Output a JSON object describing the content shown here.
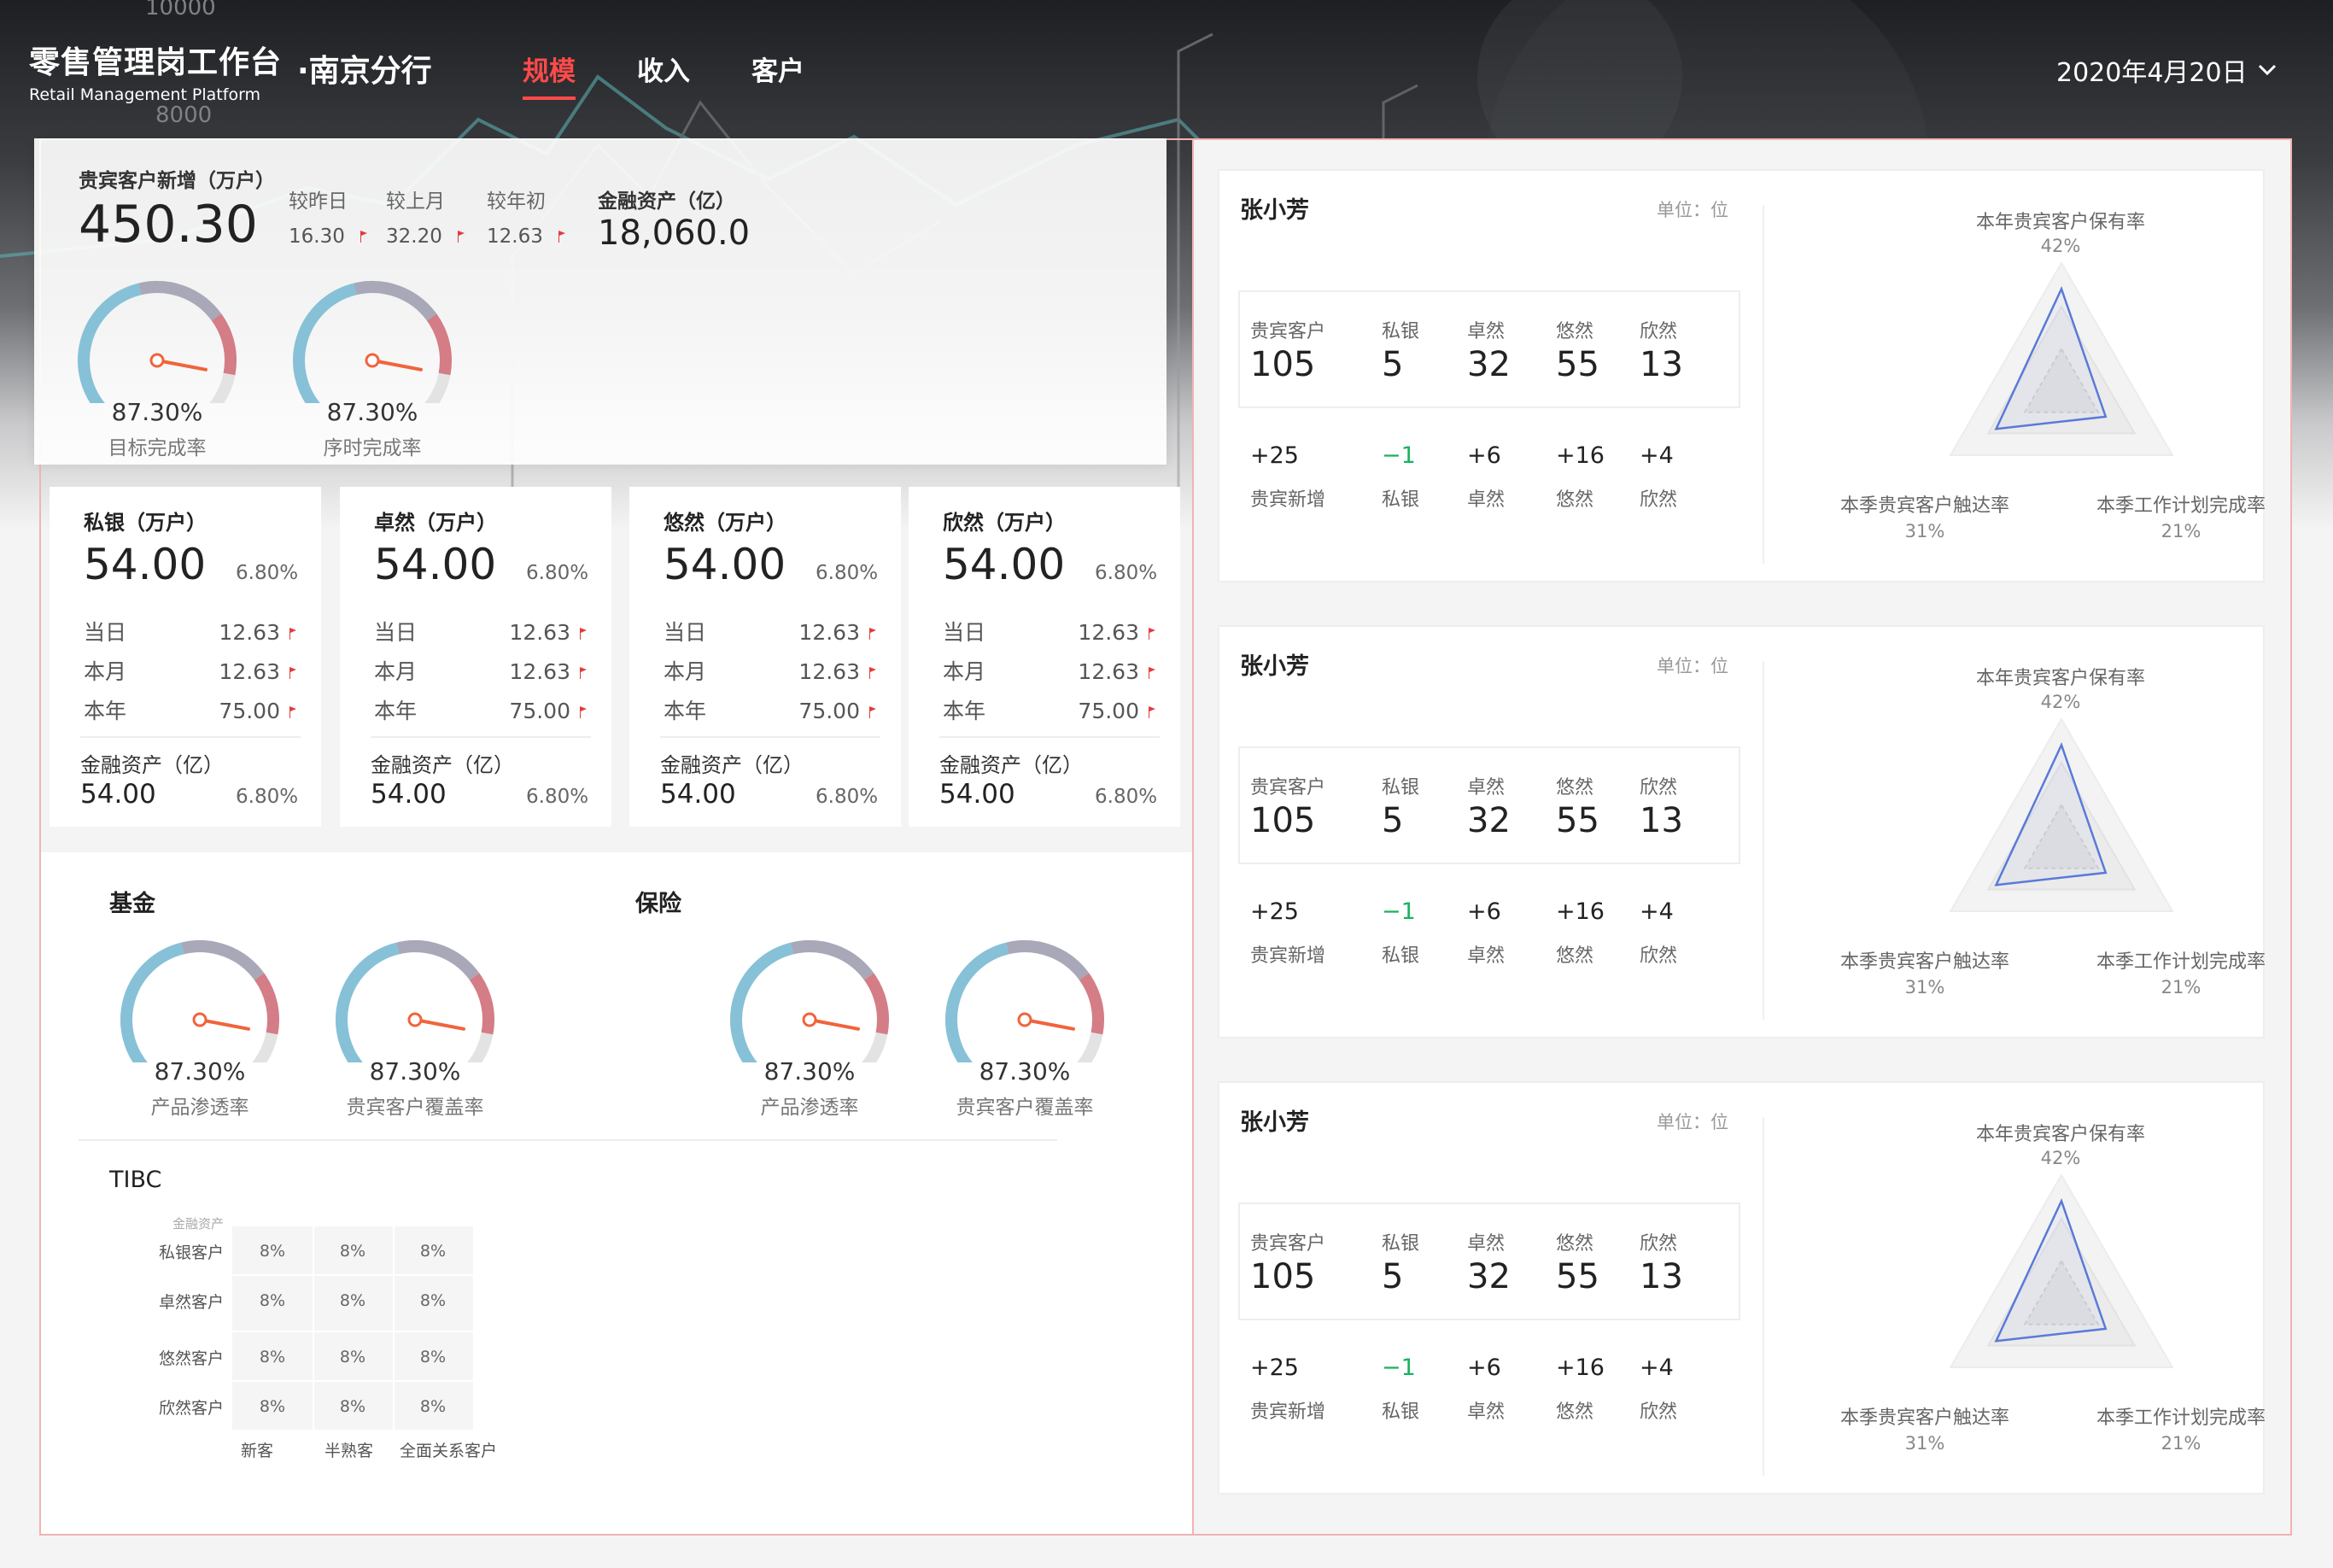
{
  "header": {
    "title_cn": "零售管理岗工作台",
    "title_en": "Retail Management Platform",
    "branch": "·南京分行",
    "tabs": [
      {
        "label": "规模",
        "active": true
      },
      {
        "label": "收入",
        "active": false
      },
      {
        "label": "客户",
        "active": false
      }
    ],
    "date": "2020年4月20日",
    "accent_color": "#ff4a4a",
    "bg_axis_labels": [
      "10000",
      "8000"
    ]
  },
  "summary": {
    "new_vip_label": "贵宾客户新增（万户）",
    "new_vip_value": "450.30",
    "comparisons": [
      {
        "label": "较昨日",
        "value": "16.30"
      },
      {
        "label": "较上月",
        "value": "32.20"
      },
      {
        "label": "较年初",
        "value": "12.63"
      }
    ],
    "assets_label": "金融资产（亿）",
    "assets_value": "18,060.0",
    "gauges": [
      {
        "value": "87.30%",
        "label": "目标完成率",
        "percent": 0.873
      },
      {
        "value": "87.30%",
        "label": "序时完成率",
        "percent": 0.873
      }
    ]
  },
  "segments": [
    {
      "title": "私银（万户）",
      "value": "54.00",
      "pct": "6.80%",
      "rows": [
        {
          "label": "当日",
          "value": "12.63"
        },
        {
          "label": "本月",
          "value": "12.63"
        },
        {
          "label": "本年",
          "value": "75.00"
        }
      ],
      "assets_label": "金融资产（亿）",
      "assets_value": "54.00",
      "assets_pct": "6.80%"
    },
    {
      "title": "卓然（万户）",
      "value": "54.00",
      "pct": "6.80%",
      "rows": [
        {
          "label": "当日",
          "value": "12.63"
        },
        {
          "label": "本月",
          "value": "12.63"
        },
        {
          "label": "本年",
          "value": "75.00"
        }
      ],
      "assets_label": "金融资产（亿）",
      "assets_value": "54.00",
      "assets_pct": "6.80%"
    },
    {
      "title": "悠然（万户）",
      "value": "54.00",
      "pct": "6.80%",
      "rows": [
        {
          "label": "当日",
          "value": "12.63"
        },
        {
          "label": "本月",
          "value": "12.63"
        },
        {
          "label": "本年",
          "value": "75.00"
        }
      ],
      "assets_label": "金融资产（亿）",
      "assets_value": "54.00",
      "assets_pct": "6.80%"
    },
    {
      "title": "欣然（万户）",
      "value": "54.00",
      "pct": "6.80%",
      "rows": [
        {
          "label": "当日",
          "value": "12.63"
        },
        {
          "label": "本月",
          "value": "12.63"
        },
        {
          "label": "本年",
          "value": "75.00"
        }
      ],
      "assets_label": "金融资产（亿）",
      "assets_value": "54.00",
      "assets_pct": "6.80%"
    }
  ],
  "fund": {
    "title": "基金",
    "gauges": [
      {
        "value": "87.30%",
        "label": "产品渗透率",
        "percent": 0.873
      },
      {
        "value": "87.30%",
        "label": "贵宾客户覆盖率",
        "percent": 0.873
      }
    ]
  },
  "insurance": {
    "title": "保险",
    "gauges": [
      {
        "value": "87.30%",
        "label": "产品渗透率",
        "percent": 0.873
      },
      {
        "value": "87.30%",
        "label": "贵宾客户覆盖率",
        "percent": 0.873
      }
    ]
  },
  "tibc": {
    "title": "TIBC",
    "corner_label": "金融资产",
    "row_labels": [
      "私银客户",
      "卓然客户",
      "悠然客户",
      "欣然客户"
    ],
    "col_labels": [
      "新客",
      "半熟客",
      "全面关系客户"
    ],
    "cells": [
      [
        "8%",
        "8%",
        "8%"
      ],
      [
        "8%",
        "8%",
        "8%"
      ],
      [
        "8%",
        "8%",
        "8%"
      ],
      [
        "8%",
        "8%",
        "8%"
      ]
    ]
  },
  "managers": [
    {
      "name": "张小芳",
      "unit": "单位：位",
      "counts": [
        {
          "label": "贵宾客户",
          "value": "105"
        },
        {
          "label": "私银",
          "value": "5"
        },
        {
          "label": "卓然",
          "value": "32"
        },
        {
          "label": "悠然",
          "value": "55"
        },
        {
          "label": "欣然",
          "value": "13"
        }
      ],
      "deltas": [
        {
          "label": "贵宾新增",
          "value": "+25"
        },
        {
          "label": "私银",
          "value": "−1"
        },
        {
          "label": "卓然",
          "value": "+6"
        },
        {
          "label": "悠然",
          "value": "+16"
        },
        {
          "label": "欣然",
          "value": "+4"
        }
      ],
      "radar": [
        {
          "label": "本年贵宾客户保有率",
          "value": "42%"
        },
        {
          "label": "本季贵宾客户触达率",
          "value": "31%"
        },
        {
          "label": "本季工作计划完成率",
          "value": "21%"
        }
      ]
    },
    {
      "name": "张小芳",
      "unit": "单位：位",
      "counts": [
        {
          "label": "贵宾客户",
          "value": "105"
        },
        {
          "label": "私银",
          "value": "5"
        },
        {
          "label": "卓然",
          "value": "32"
        },
        {
          "label": "悠然",
          "value": "55"
        },
        {
          "label": "欣然",
          "value": "13"
        }
      ],
      "deltas": [
        {
          "label": "贵宾新增",
          "value": "+25"
        },
        {
          "label": "私银",
          "value": "−1"
        },
        {
          "label": "卓然",
          "value": "+6"
        },
        {
          "label": "悠然",
          "value": "+16"
        },
        {
          "label": "欣然",
          "value": "+4"
        }
      ],
      "radar": [
        {
          "label": "本年贵宾客户保有率",
          "value": "42%"
        },
        {
          "label": "本季贵宾客户触达率",
          "value": "31%"
        },
        {
          "label": "本季工作计划完成率",
          "value": "21%"
        }
      ]
    },
    {
      "name": "张小芳",
      "unit": "单位：位",
      "counts": [
        {
          "label": "贵宾客户",
          "value": "105"
        },
        {
          "label": "私银",
          "value": "5"
        },
        {
          "label": "卓然",
          "value": "32"
        },
        {
          "label": "悠然",
          "value": "55"
        },
        {
          "label": "欣然",
          "value": "13"
        }
      ],
      "deltas": [
        {
          "label": "贵宾新增",
          "value": "+25"
        },
        {
          "label": "私银",
          "value": "−1"
        },
        {
          "label": "卓然",
          "value": "+6"
        },
        {
          "label": "悠然",
          "value": "+16"
        },
        {
          "label": "欣然",
          "value": "+4"
        }
      ],
      "radar": [
        {
          "label": "本年贵宾客户保有率",
          "value": "42%"
        },
        {
          "label": "本季贵宾客户触达率",
          "value": "31%"
        },
        {
          "label": "本季工作计划完成率",
          "value": "21%"
        }
      ]
    }
  ]
}
